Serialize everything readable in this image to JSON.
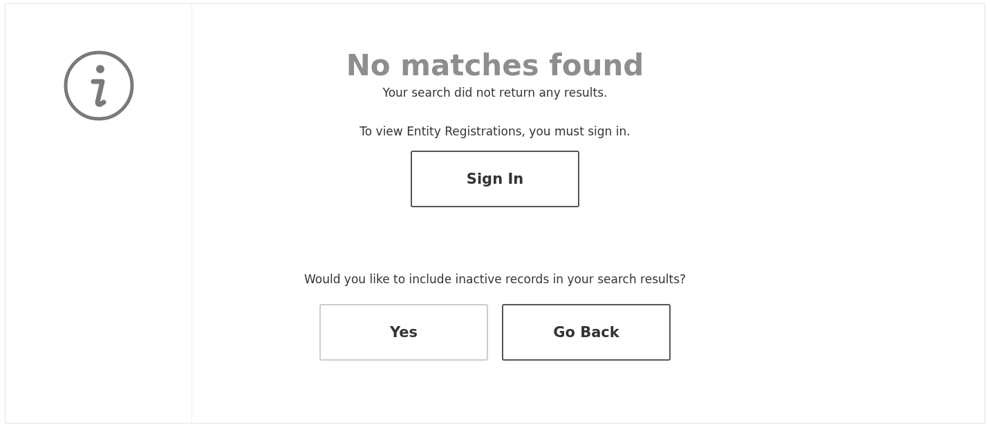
{
  "title": "No matches found",
  "subtitle": "Your search did not return any results.",
  "sign_in_prompt": "To view Entity Registrations, you must sign in.",
  "sign_in_button": {
    "label": "Sign In",
    "emphasized": true
  },
  "question": "Would you like to include inactive records in your search results?",
  "buttons": [
    {
      "label": "Yes",
      "emphasized": false
    },
    {
      "label": "Go Back",
      "emphasized": true
    }
  ]
}
